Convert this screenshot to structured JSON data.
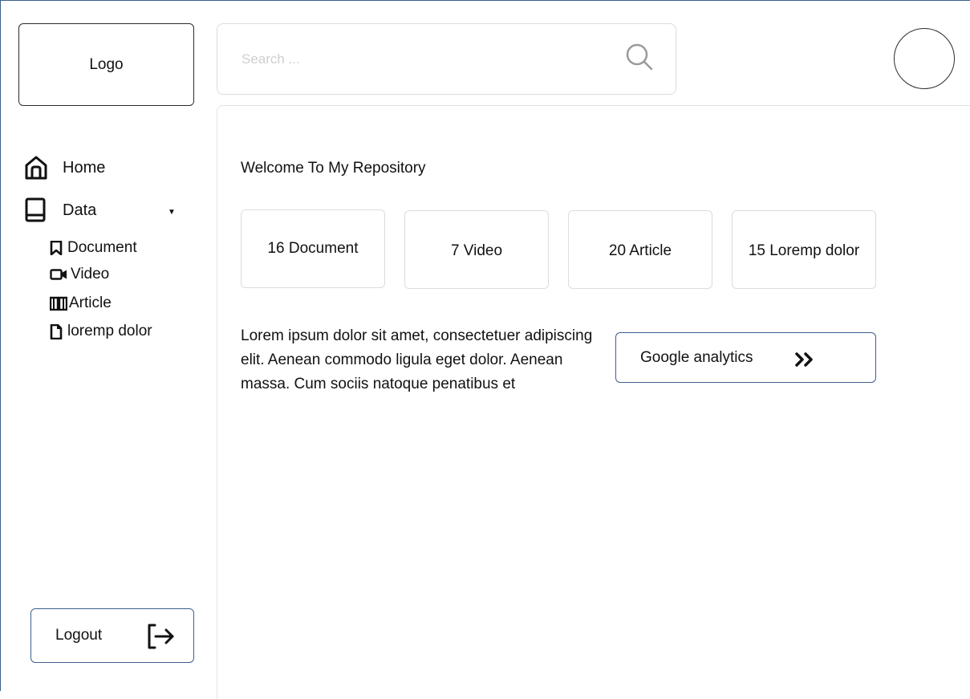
{
  "header": {
    "logo_label": "Logo",
    "search_placeholder": "Search ..."
  },
  "sidebar": {
    "items": [
      {
        "label": "Home",
        "icon": "home-icon"
      },
      {
        "label": "Data",
        "icon": "book-icon"
      }
    ],
    "sub_items": [
      {
        "label": "Document",
        "icon": "bookmark-icon"
      },
      {
        "label": "Video",
        "icon": "video-camera-icon"
      },
      {
        "label": "Article",
        "icon": "open-book-icon"
      },
      {
        "label": "loremp dolor",
        "icon": "file-icon"
      }
    ],
    "logout_label": "Logout"
  },
  "main": {
    "welcome": "Welcome To My Repository",
    "stats": [
      {
        "label": "16 Document"
      },
      {
        "label": "7 Video"
      },
      {
        "label": "20 Article"
      },
      {
        "label": "15 Loremp dolor"
      }
    ],
    "description": "Lorem ipsum dolor sit amet, consectetuer adipiscing elit. Aenean commodo ligula eget dolor. Aenean massa. Cum sociis natoque penatibus et",
    "analytics_button": "Google analytics"
  },
  "colors": {
    "accent_border": "#3d5f8f",
    "card_border": "#dcdcdc",
    "placeholder": "#cfcfcf"
  }
}
